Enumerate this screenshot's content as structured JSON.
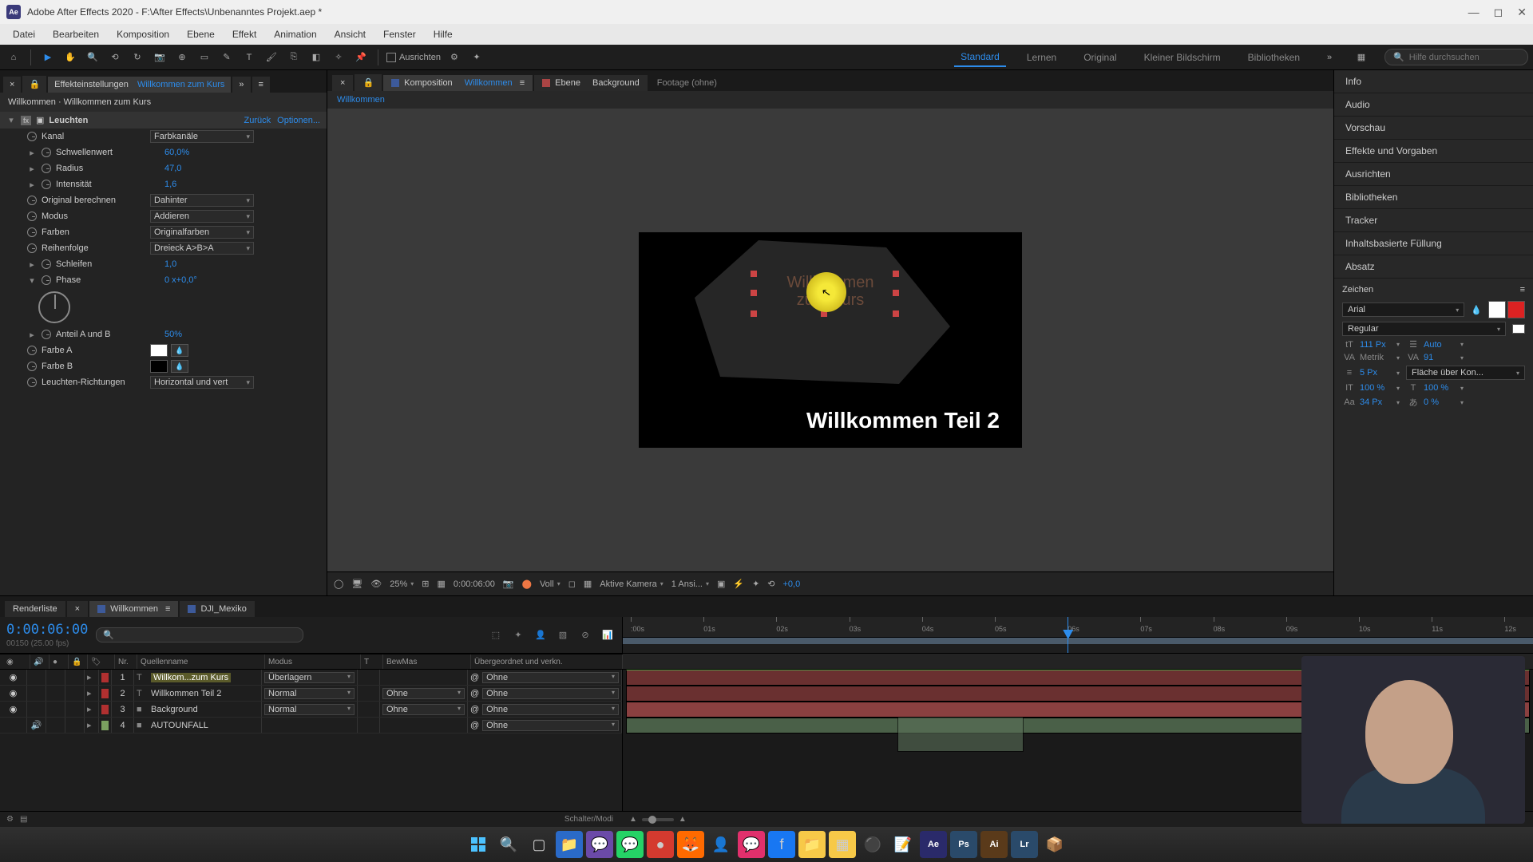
{
  "titlebar": {
    "app_name": "Adobe After Effects 2020",
    "project_path": "F:\\After Effects\\Unbenanntes Projekt.aep *"
  },
  "menu": [
    "Datei",
    "Bearbeiten",
    "Komposition",
    "Ebene",
    "Effekt",
    "Animation",
    "Ansicht",
    "Fenster",
    "Hilfe"
  ],
  "toolbar_checkbox": "Ausrichten",
  "workspaces": [
    "Standard",
    "Lernen",
    "Original",
    "Kleiner Bildschirm",
    "Bibliotheken"
  ],
  "active_workspace": 0,
  "help_search_placeholder": "Hilfe durchsuchen",
  "left_panel": {
    "tab1": "Effekteinstellungen",
    "tab1_target": "Willkommen zum Kurs",
    "breadcrumb": "Willkommen · Willkommen zum Kurs",
    "effect_name": "Leuchten",
    "link_back": "Zurück",
    "link_opts": "Optionen...",
    "props": {
      "kanal": {
        "label": "Kanal",
        "value": "Farbkanäle"
      },
      "schwellenwert": {
        "label": "Schwellenwert",
        "value": "60,0%"
      },
      "radius": {
        "label": "Radius",
        "value": "47,0"
      },
      "intensitaet": {
        "label": "Intensität",
        "value": "1,6"
      },
      "orig": {
        "label": "Original berechnen",
        "value": "Dahinter"
      },
      "modus": {
        "label": "Modus",
        "value": "Addieren"
      },
      "farben": {
        "label": "Farben",
        "value": "Originalfarben"
      },
      "reihenfolge": {
        "label": "Reihenfolge",
        "value": "Dreieck A>B>A"
      },
      "schleifen": {
        "label": "Schleifen",
        "value": "1,0"
      },
      "phase": {
        "label": "Phase",
        "value": "0 x+0,0°"
      },
      "anteil": {
        "label": "Anteil A und B",
        "value": "50%"
      },
      "farbeA": {
        "label": "Farbe A"
      },
      "farbeB": {
        "label": "Farbe B"
      },
      "richtungen": {
        "label": "Leuchten-Richtungen",
        "value": "Horizontal und vert"
      }
    }
  },
  "center": {
    "tab_comp_prefix": "Komposition",
    "tab_comp_name": "Willkommen",
    "tab_layer_prefix": "Ebene",
    "tab_layer_name": "Background",
    "tab_footage": "Footage (ohne)",
    "flow_current": "Willkommen",
    "canvas_text_main": "Willkommen Teil 2",
    "canvas_text_ghost1": "Willkommen",
    "canvas_text_ghost2": "zum Kurs",
    "view_controls": {
      "zoom": "25%",
      "timecode": "0:00:06:00",
      "res": "Voll",
      "camera": "Aktive Kamera",
      "views": "1 Ansi...",
      "exposure": "+0,0"
    }
  },
  "right_panels": [
    "Info",
    "Audio",
    "Vorschau",
    "Effekte und Vorgaben",
    "Ausrichten",
    "Bibliotheken",
    "Tracker",
    "Inhaltsbasierte Füllung",
    "Absatz"
  ],
  "char_panel": {
    "title": "Zeichen",
    "font": "Arial",
    "style": "Regular",
    "size": "111 Px",
    "leading": "Auto",
    "kerning": "Metrik",
    "tracking": "91",
    "stroke_w": "5 Px",
    "stroke_mode": "Fläche über Kon...",
    "vscale": "100 %",
    "hscale": "100 %",
    "baseline": "34 Px",
    "tsume": "0 %"
  },
  "timeline": {
    "tab_render": "Renderliste",
    "tab_comp": "Willkommen",
    "tab_dji": "DJI_Mexiko",
    "timecode": "0:00:06:00",
    "frames": "00150 (25.00 fps)",
    "cols": {
      "nr": "Nr.",
      "quelle": "Quellenname",
      "modus": "Modus",
      "t": "T",
      "bewmas": "BewMas",
      "parent": "Übergeordnet und verkn."
    },
    "layers": [
      {
        "nr": "1",
        "name": "Willkom...zum Kurs",
        "mode": "Überlagern",
        "bewmas": "",
        "parent": "Ohne",
        "type": "T",
        "color": "#b03030",
        "selected": true
      },
      {
        "nr": "2",
        "name": "Willkommen Teil 2",
        "mode": "Normal",
        "bewmas": "Ohne",
        "parent": "Ohne",
        "type": "T",
        "color": "#b03030"
      },
      {
        "nr": "3",
        "name": "Background",
        "mode": "Normal",
        "bewmas": "Ohne",
        "parent": "Ohne",
        "type": "",
        "color": "#b03030"
      },
      {
        "nr": "4",
        "name": "AUTOUNFALL",
        "mode": "",
        "bewmas": "",
        "parent": "Ohne",
        "type": "",
        "color": "#7aa060"
      }
    ],
    "ruler_marks": [
      ":00s",
      "01s",
      "02s",
      "03s",
      "04s",
      "05s",
      "06s",
      "07s",
      "08s",
      "09s",
      "10s",
      "11s",
      "12s"
    ],
    "playhead_sec": 6,
    "footer": "Schalter/Modi"
  }
}
